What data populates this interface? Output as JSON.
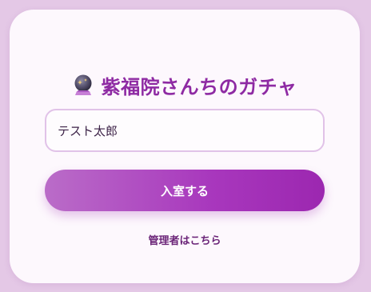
{
  "header": {
    "title": "紫福院さんちのガチャ",
    "icon": "crystal-ball-icon"
  },
  "login": {
    "name_value": "テスト太郎",
    "enter_label": "入室する",
    "admin_link": "管理者はこちら"
  },
  "colors": {
    "background": "#e4c8e6",
    "card": "#fdf8fd",
    "title": "#8e2aa3",
    "button_start": "#ba6cc8",
    "button_end": "#9c27b0",
    "input_border": "#e1c2e8",
    "link": "#6b2478"
  }
}
